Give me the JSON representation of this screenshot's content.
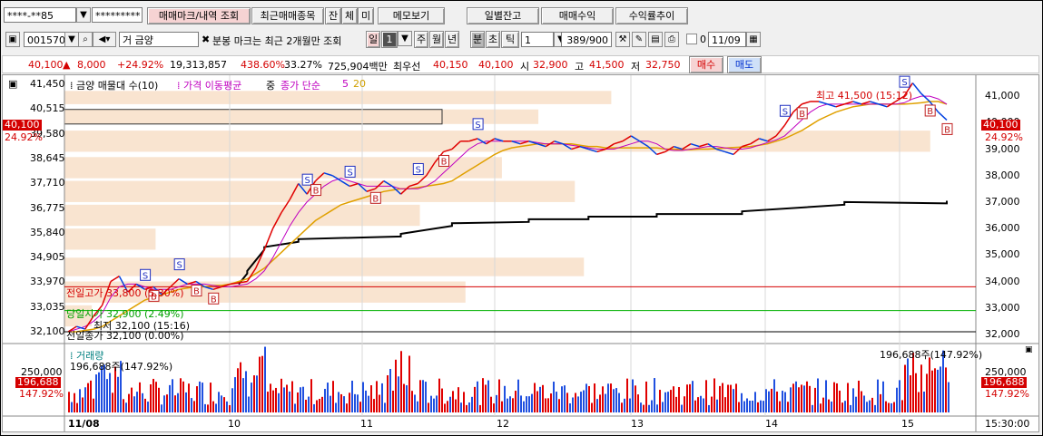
{
  "toolbar1": {
    "account_masked": "****-**85",
    "password_masked": "*********",
    "buttons": [
      "매매마크/내역 조회",
      "최근매매종목",
      "잔",
      "체",
      "미",
      "메모보기"
    ],
    "right_buttons": [
      "일별잔고",
      "매매수익",
      "수익률추이"
    ]
  },
  "toolbar2": {
    "code": "001570",
    "name": "거 금양",
    "notice": "분봉 마크는 최근 2개월만 조회",
    "periods": [
      "일",
      "1",
      "주",
      "월",
      "년",
      "분",
      "초",
      "틱"
    ],
    "interval": "1",
    "count": "389/900",
    "check_label": "0",
    "date": "11/09"
  },
  "quote": {
    "price": "40,100",
    "change": "8,000",
    "change_pct": "+24.92%",
    "volume": "19,313,857",
    "vol_ratio": "438.60%",
    "rate": "33.27%",
    "amount": "725,904백만",
    "best_label": "최우선",
    "best_ask": "40,150",
    "best_bid": "40,100",
    "open_label": "시",
    "open": "32,900",
    "high_label": "고",
    "high": "41,500",
    "low_label": "저",
    "low": "32,750",
    "buy": "매수",
    "sell": "매도"
  },
  "legend": {
    "main": "금양 매물대 수(10)",
    "ma": "가격 이동평균",
    "mid": "중",
    "close": "종가 단순",
    "n5": "5",
    "n20": "20"
  },
  "annotations": {
    "high": "최고 41,500 (15:12)",
    "prev_high": "전일고가 33,800 (5.30%)",
    "open_price": "당일시가 32,900 (2.49%)",
    "low": "최저 32,100 (15:16)",
    "prev_close": "전일종가 32,100 (0.00%)",
    "vol_title": "거래량",
    "vol_left": "196,688주(147.92%)",
    "vol_right": "196,688주(147.92%)"
  },
  "price_tag": {
    "price": "40,100",
    "pct": "24.92%"
  },
  "vol_tag": {
    "value": "196,688",
    "pct": "147.92%",
    "axis": "250,000"
  },
  "chart_data": {
    "type": "line",
    "y_axis_left": [
      "41,450",
      "40,515",
      "39,580",
      "38,645",
      "37,710",
      "36,775",
      "35,840",
      "34,905",
      "33,970",
      "33,035",
      "32,100"
    ],
    "y_axis_right": [
      "41,000",
      "40,000",
      "39,000",
      "38,000",
      "37,000",
      "36,000",
      "35,000",
      "34,000",
      "33,000",
      "32,000"
    ],
    "x_labels": [
      "11/08",
      "10",
      "11",
      "12",
      "13",
      "14",
      "15",
      "15:30:00"
    ],
    "volume_axis": "250,000",
    "prices": [
      32100,
      32300,
      32200,
      32700,
      33100,
      34000,
      34200,
      33600,
      33900,
      33700,
      33800,
      33500,
      33800,
      34100,
      33900,
      34000,
      33800,
      33700,
      33800,
      33900,
      33950,
      34000,
      34500,
      35200,
      36000,
      36600,
      37100,
      37700,
      37300,
      37800,
      38100,
      38000,
      37800,
      37600,
      37700,
      37400,
      37500,
      37800,
      37600,
      37300,
      37600,
      37700,
      38000,
      38500,
      38900,
      39000,
      39300,
      39300,
      39400,
      39200,
      39400,
      39300,
      39300,
      39200,
      39300,
      39200,
      39100,
      39300,
      39200,
      39000,
      39100,
      39000,
      38900,
      39000,
      39200,
      39300,
      39500,
      39300,
      39100,
      38800,
      38900,
      39100,
      39000,
      39200,
      39100,
      39200,
      39000,
      38900,
      38800,
      39100,
      39200,
      39400,
      39300,
      39500,
      39900,
      40400,
      40700,
      40800,
      40800,
      40700,
      40600,
      40700,
      40800,
      40700,
      40800,
      40700,
      40600,
      40800,
      41000,
      41500,
      41100,
      40800,
      40400,
      40100
    ],
    "ma5": [
      32100,
      32200,
      32300,
      32500,
      32800,
      33400,
      33800,
      33900,
      33900,
      33800,
      33700,
      33700,
      33700,
      33800,
      33900,
      33900,
      33900,
      33850,
      33800,
      33800,
      33850,
      33900,
      34100,
      34400,
      34900,
      35500,
      36100,
      36600,
      37000,
      37300,
      37600,
      37800,
      37900,
      37800,
      37700,
      37600,
      37600,
      37600,
      37600,
      37500,
      37500,
      37500,
      37600,
      37800,
      38100,
      38400,
      38700,
      39000,
      39200,
      39300,
      39300,
      39300,
      39300,
      39300,
      39300,
      39250,
      39200,
      39200,
      39200,
      39150,
      39100,
      39050,
      39000,
      39000,
      39000,
      39100,
      39200,
      39300,
      39300,
      39200,
      39000,
      38950,
      38950,
      39000,
      39050,
      39100,
      39100,
      39050,
      39000,
      39000,
      39050,
      39150,
      39250,
      39350,
      39500,
      39800,
      40100,
      40400,
      40600,
      40700,
      40700,
      40700,
      40700,
      40700,
      40700,
      40700,
      40700,
      40700,
      40750,
      40900,
      41000,
      41000,
      40900,
      40700
    ],
    "ma20": [
      32100,
      32100,
      32150,
      32200,
      32300,
      32500,
      32700,
      32900,
      33100,
      33300,
      33400,
      33500,
      33600,
      33700,
      33750,
      33800,
      33800,
      33850,
      33850,
      33900,
      34000,
      34100,
      34300,
      34500,
      34800,
      35100,
      35400,
      35700,
      36000,
      36300,
      36500,
      36700,
      36900,
      37000,
      37100,
      37200,
      37300,
      37400,
      37450,
      37500,
      37500,
      37550,
      37600,
      37650,
      37700,
      37800,
      38000,
      38200,
      38400,
      38600,
      38800,
      38950,
      39050,
      39100,
      39150,
      39200,
      39200,
      39200,
      39200,
      39200,
      39150,
      39100,
      39100,
      39050,
      39050,
      39050,
      39050,
      39050,
      39050,
      39050,
      39000,
      39000,
      38980,
      38980,
      39000,
      39000,
      39020,
      39040,
      39060,
      39080,
      39100,
      39150,
      39200,
      39300,
      39400,
      39550,
      39700,
      39900,
      40100,
      40250,
      40400,
      40500,
      40600,
      40650,
      40700,
      40700,
      40700,
      40700,
      40700,
      40720,
      40750,
      40800,
      40800,
      40700
    ],
    "volume_profile": [
      {
        "price_from": 40700,
        "price_to": 41200,
        "width": 0.6
      },
      {
        "price_from": 39950,
        "price_to": 40500,
        "width": 0.52
      },
      {
        "price_from": 38900,
        "price_to": 39700,
        "width": 0.95
      },
      {
        "price_from": 37900,
        "price_to": 38700,
        "width": 0.48
      },
      {
        "price_from": 37000,
        "price_to": 37800,
        "width": 0.56
      },
      {
        "price_from": 36100,
        "price_to": 36900,
        "width": 0.39
      },
      {
        "price_from": 35200,
        "price_to": 36000,
        "width": 0.1
      },
      {
        "price_from": 34200,
        "price_to": 34900,
        "width": 0.57
      },
      {
        "price_from": 33200,
        "price_to": 34000,
        "width": 0.44
      },
      {
        "price_from": 32300,
        "price_to": 33100,
        "width": 0.03
      }
    ],
    "reference_lines": [
      {
        "name": "prev-high",
        "price": 33800,
        "color": "#d40000"
      },
      {
        "name": "open",
        "price": 32900,
        "color": "#00b000"
      },
      {
        "name": "prev-close",
        "price": 32100,
        "color": "#000000"
      }
    ]
  }
}
